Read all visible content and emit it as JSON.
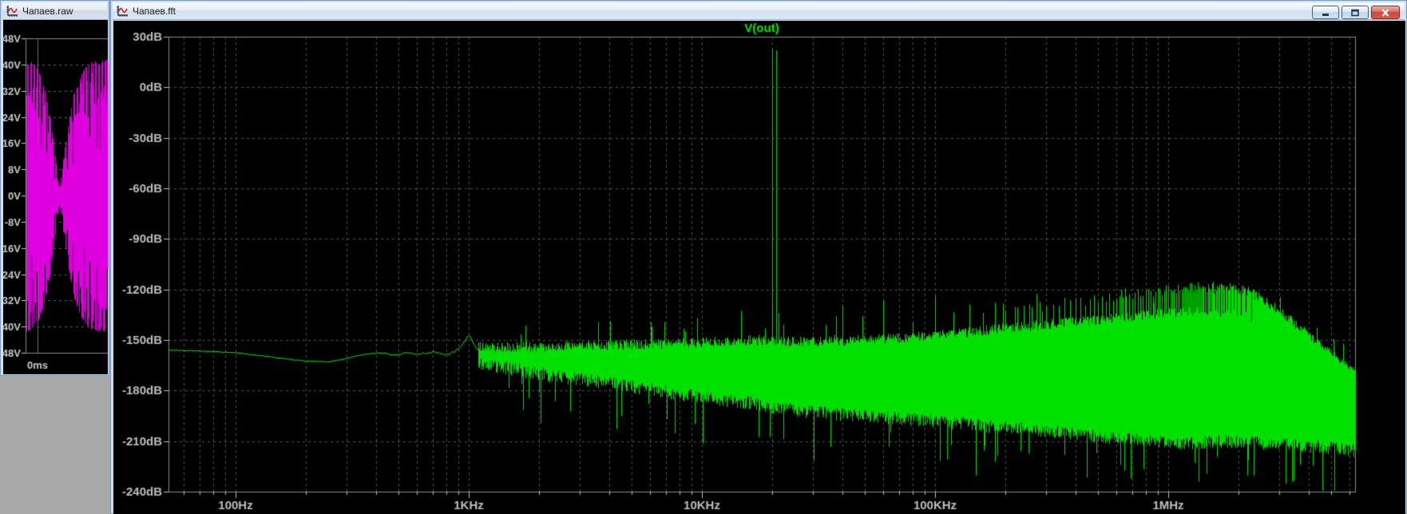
{
  "desktop": {
    "background": "#a9a9a9"
  },
  "windows": {
    "raw": {
      "title": "Чапаев.raw",
      "icon": "waveform-plot-icon",
      "active": false
    },
    "fft": {
      "title": "Чапаев.fft",
      "icon": "waveform-plot-icon",
      "active": true,
      "caption_buttons": [
        "minimize",
        "maximize",
        "close"
      ]
    }
  },
  "chart_data": [
    {
      "type": "line",
      "name": "raw-time-domain-trace",
      "trace_color": "#de00de",
      "grid_color": "#5f5f5f",
      "axis_color": "#8a8a8a",
      "label_color": "#c9c9c9",
      "ylim_volts": [
        -48,
        48
      ],
      "ytick_labels": [
        "48V",
        "40V",
        "32V",
        "24V",
        "16V",
        "8V",
        "0V",
        "-8V",
        "-16V",
        "-24V",
        "-32V",
        "-40V",
        "-48V"
      ],
      "ytick_values": [
        48,
        40,
        32,
        24,
        16,
        8,
        0,
        -8,
        -16,
        -24,
        -32,
        -40,
        -48
      ],
      "xtick_labels": [
        "0ms"
      ],
      "envelope_volts": [
        [
          0.0,
          41.5
        ],
        [
          0.05,
          41.0
        ],
        [
          0.1,
          40.0
        ],
        [
          0.15,
          38.0
        ],
        [
          0.2,
          34.5
        ],
        [
          0.25,
          29.5
        ],
        [
          0.3,
          23.0
        ],
        [
          0.34,
          16.0
        ],
        [
          0.37,
          9.0
        ],
        [
          0.4,
          2.5
        ],
        [
          0.43,
          6.0
        ],
        [
          0.46,
          12.0
        ],
        [
          0.5,
          19.0
        ],
        [
          0.54,
          25.0
        ],
        [
          0.58,
          30.5
        ],
        [
          0.64,
          35.0
        ],
        [
          0.71,
          38.5
        ],
        [
          0.79,
          40.5
        ],
        [
          0.88,
          41.3
        ],
        [
          1.0,
          41.5
        ]
      ]
    },
    {
      "type": "line",
      "name": "fft-spectrum",
      "title": "V(out)",
      "title_color": "#00e800",
      "trace_color": "#00e100",
      "grid_color": "#525252",
      "axis_color": "#8a8a8a",
      "label_color": "#bdbdbd",
      "xscale": "log",
      "xlim_hz": [
        52,
        6300000
      ],
      "ylim_db": [
        -240,
        30
      ],
      "ytick_db": [
        30,
        0,
        -30,
        -60,
        -90,
        -120,
        -150,
        -180,
        -210,
        -240
      ],
      "ytick_labels": [
        "30dB",
        "0dB",
        "-30dB",
        "-60dB",
        "-90dB",
        "-120dB",
        "-150dB",
        "-180dB",
        "-210dB",
        "-240dB"
      ],
      "xtick_hz": [
        100,
        1000,
        10000,
        100000,
        1000000
      ],
      "xtick_labels": [
        "100Hz",
        "1KHz",
        "10KHz",
        "100KHz",
        "1MHz"
      ],
      "grid_style": "dashed",
      "fundamental": {
        "freq_hz": 20000,
        "peak_db": 23
      },
      "smooth_floor_db": [
        [
          52,
          -156
        ],
        [
          70,
          -156.5
        ],
        [
          100,
          -157.5
        ],
        [
          150,
          -160.5
        ],
        [
          200,
          -162.5
        ],
        [
          250,
          -163
        ],
        [
          300,
          -161
        ],
        [
          350,
          -158.5
        ],
        [
          420,
          -157.5
        ],
        [
          480,
          -159
        ],
        [
          540,
          -157.5
        ],
        [
          620,
          -158.5
        ],
        [
          700,
          -157
        ],
        [
          780,
          -158.5
        ],
        [
          860,
          -157.5
        ],
        [
          930,
          -154
        ],
        [
          1000,
          -147
        ],
        [
          1060,
          -153
        ],
        [
          1100,
          -156
        ]
      ],
      "noise_band_db": [
        [
          1100,
          -154,
          -164
        ],
        [
          2000,
          -154,
          -170
        ],
        [
          4000,
          -153,
          -176
        ],
        [
          8000,
          -152,
          -182
        ],
        [
          15000,
          -150,
          -187
        ],
        [
          25000,
          -151,
          -192
        ],
        [
          50000,
          -150,
          -195
        ],
        [
          100000,
          -147,
          -198
        ],
        [
          200000,
          -143,
          -202
        ],
        [
          400000,
          -139,
          -206
        ],
        [
          700000,
          -136,
          -209
        ],
        [
          1200000,
          -133,
          -211
        ],
        [
          2000000,
          -134,
          -210
        ],
        [
          3000000,
          -143,
          -212
        ],
        [
          4000000,
          -152,
          -213
        ],
        [
          5000000,
          -160,
          -214
        ],
        [
          6300000,
          -170,
          -216
        ]
      ],
      "tip_envelope_db": [
        [
          40000,
          -130
        ],
        [
          60000,
          -126
        ],
        [
          80000,
          -138
        ],
        [
          100000,
          -126
        ],
        [
          120000,
          -135
        ],
        [
          140000,
          -129
        ],
        [
          160000,
          -134
        ],
        [
          180000,
          -128
        ],
        [
          220000,
          -131
        ],
        [
          300000,
          -129
        ],
        [
          500000,
          -126
        ],
        [
          800000,
          -122
        ],
        [
          1200000,
          -119
        ],
        [
          1700000,
          -118
        ],
        [
          2200000,
          -121
        ],
        [
          2700000,
          -128
        ],
        [
          3200000,
          -136
        ],
        [
          3800000,
          -145
        ],
        [
          4500000,
          -154
        ],
        [
          5500000,
          -163
        ],
        [
          6300000,
          -170
        ]
      ],
      "harmonic_spacing_hz": 20000,
      "sidebands_db": [
        [
          16000,
          -152
        ],
        [
          17500,
          -147
        ],
        [
          18600,
          -143
        ],
        [
          21400,
          -134
        ],
        [
          22400,
          -141
        ],
        [
          23500,
          -148
        ]
      ]
    }
  ]
}
